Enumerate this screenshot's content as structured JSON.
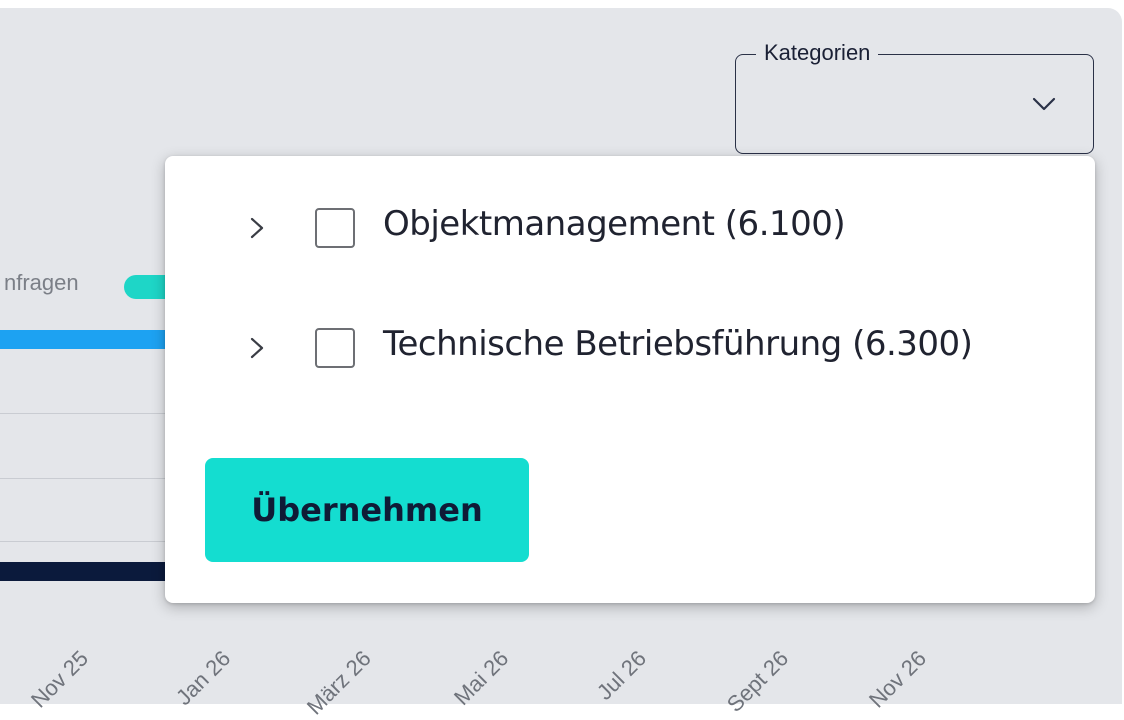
{
  "filter": {
    "label": "Kategorien",
    "chevron_icon": "chevron-down-icon"
  },
  "chart_fragment": {
    "legend_text": "nfragen",
    "colors": {
      "teal": "#1ed6c7",
      "blue": "#1da2f2",
      "navy": "#0b1a3c"
    },
    "x_ticks": [
      "Nov 25",
      "Jan 26",
      "März 26",
      "Mai 26",
      "Jul 26",
      "Sept 26",
      "Nov 26"
    ]
  },
  "dropdown": {
    "options": [
      {
        "label": "Objektmanagement (6.100)",
        "checked": false,
        "expand_icon": "chevron-right-icon"
      },
      {
        "label": "Technische Betriebsführung (6.300)",
        "checked": false,
        "expand_icon": "chevron-right-icon"
      }
    ],
    "apply_label": "Übernehmen",
    "apply_color": "#14ddd0"
  }
}
